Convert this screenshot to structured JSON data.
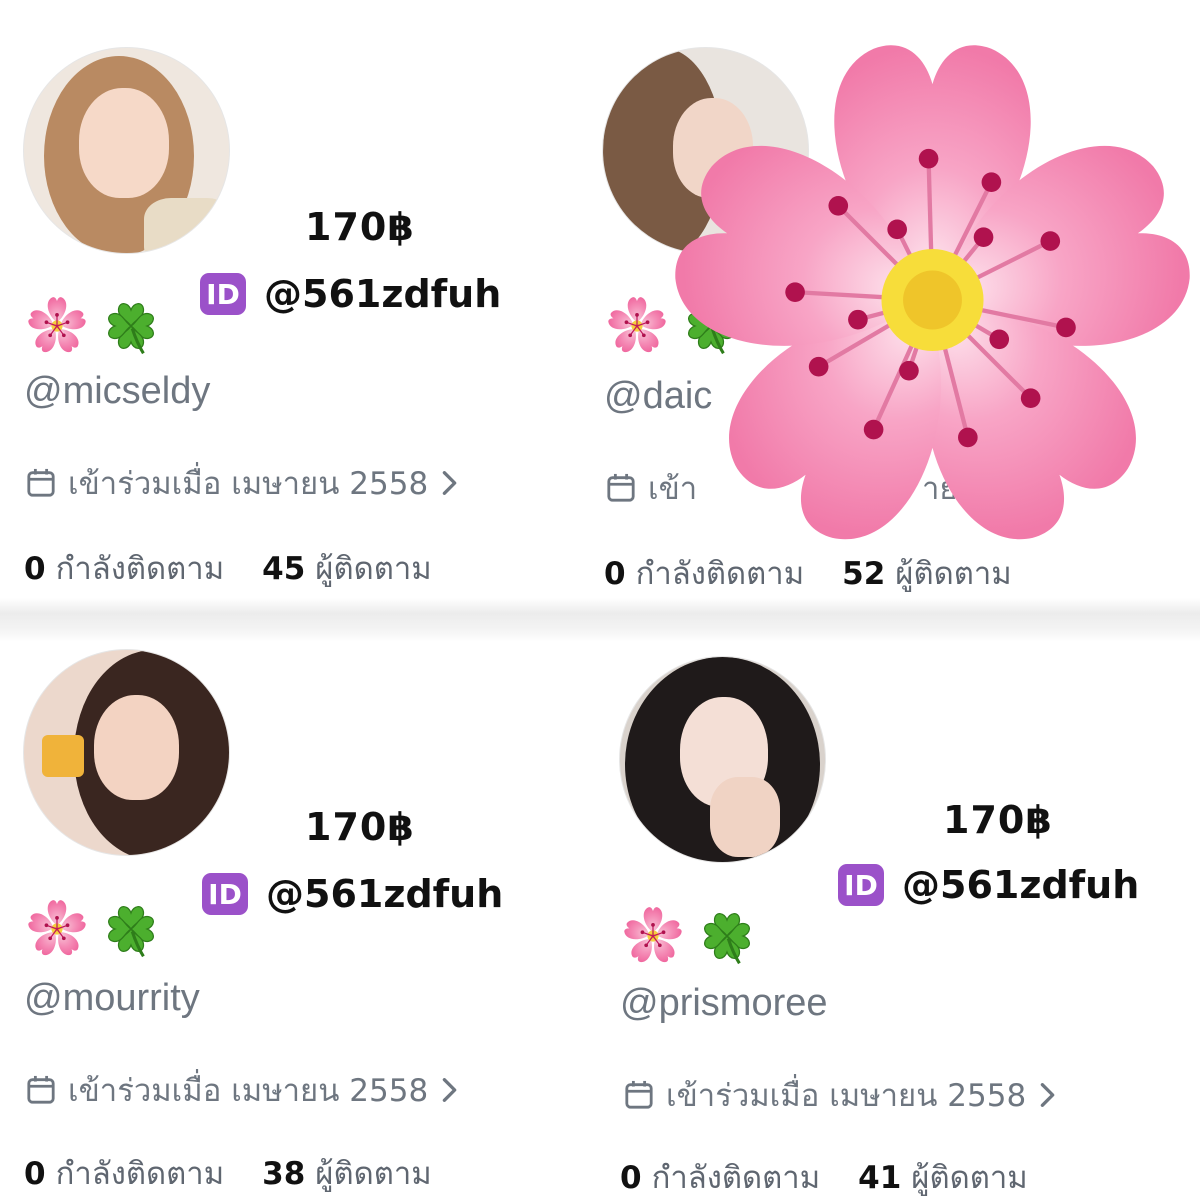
{
  "cards": [
    {
      "price": "170฿",
      "id_handle": "@561zdfuh",
      "handle": "@micseldy",
      "joined": "เข้าร่วมเมื่อ เมษายน 2558",
      "following_count": "0",
      "following_label": "กำลังติดตาม",
      "followers_count": "45",
      "followers_label": "ผู้ติดตาม"
    },
    {
      "price": "",
      "id_handle": "",
      "handle": "@daic",
      "joined": "เข้า",
      "joined_tail": "าย",
      "following_count": "0",
      "following_label": "กำลังติดตาม",
      "followers_count": "52",
      "followers_label": "ผู้ติดตาม"
    },
    {
      "price": "170฿",
      "id_handle": "@561zdfuh",
      "handle": "@mourrity",
      "joined": "เข้าร่วมเมื่อ เมษายน 2558",
      "following_count": "0",
      "following_label": "กำลังติดตาม",
      "followers_count": "38",
      "followers_label": "ผู้ติดตาม"
    },
    {
      "price": "170฿",
      "id_handle": "@561zdfuh",
      "handle": "@prismoree",
      "joined": "เข้าร่วมเมื่อ เมษายน 2558",
      "following_count": "0",
      "following_label": "กำลังติดตาม",
      "followers_count": "41",
      "followers_label": "ผู้ติดตาม"
    }
  ],
  "id_badge_text": "ID",
  "icons": [
    "cherry-blossom-icon",
    "four-leaf-clover-icon",
    "id-icon",
    "calendar-icon",
    "chevron-right-icon"
  ],
  "colors": {
    "id_badge": "#9b51c9",
    "muted_text": "#6e7680",
    "blossom": "#f48bb6",
    "clover": "#4caf2e"
  }
}
